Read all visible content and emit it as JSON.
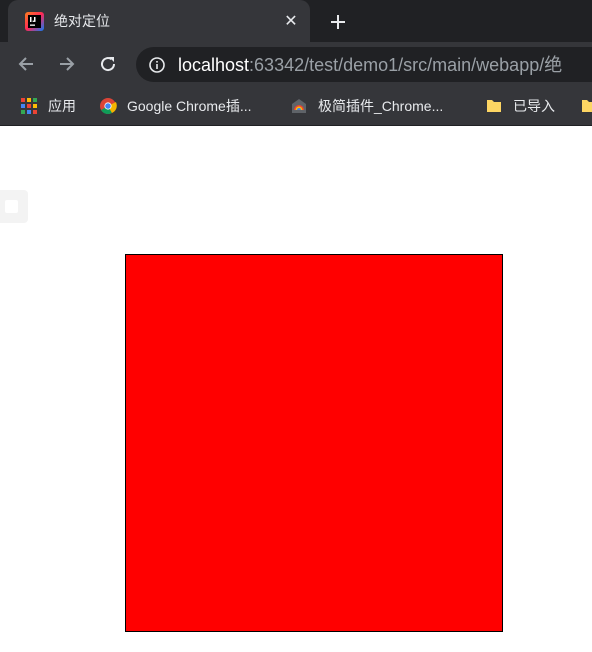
{
  "browser": {
    "tab": {
      "title": "绝对定位",
      "close_glyph": "✕",
      "favicon": "intellij-idea-icon"
    },
    "address_bar": {
      "host": "localhost",
      "path": ":63342/test/demo1/src/main/webapp/绝"
    },
    "bookmarks": [
      {
        "label": "应用",
        "icon": "apps-grid-icon"
      },
      {
        "label": "Google Chrome插...",
        "icon": "chrome-icon"
      },
      {
        "label": "极简插件_Chrome...",
        "icon": "extension-store-icon"
      },
      {
        "label": "已导入",
        "icon": "folder-icon"
      }
    ]
  },
  "page": {
    "box_color": "#ff0000"
  },
  "colors": {
    "frame": "#202124",
    "toolbar": "#35363a",
    "text": "#e8eaed"
  }
}
